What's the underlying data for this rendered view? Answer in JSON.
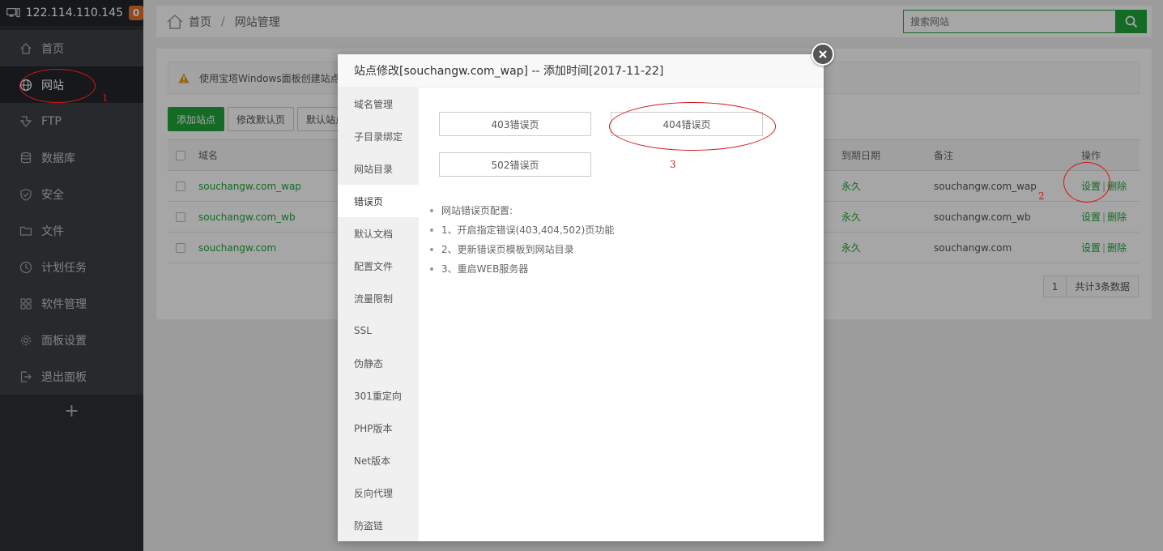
{
  "server": {
    "ip": "122.114.110.145",
    "badge": "0"
  },
  "sidebar": {
    "items": [
      {
        "label": "首页",
        "icon": "home-icon"
      },
      {
        "label": "网站",
        "icon": "globe-icon",
        "active": true
      },
      {
        "label": "FTP",
        "icon": "ftp-icon"
      },
      {
        "label": "数据库",
        "icon": "database-icon"
      },
      {
        "label": "安全",
        "icon": "shield-icon"
      },
      {
        "label": "文件",
        "icon": "folder-icon"
      },
      {
        "label": "计划任务",
        "icon": "clock-icon"
      },
      {
        "label": "软件管理",
        "icon": "grid-icon"
      },
      {
        "label": "面板设置",
        "icon": "gear-icon"
      },
      {
        "label": "退出面板",
        "icon": "logout-icon"
      }
    ],
    "add": "+"
  },
  "breadcrumb": {
    "home": "首页",
    "sep": "/",
    "current": "网站管理"
  },
  "search": {
    "placeholder": "搜索网站"
  },
  "notice": {
    "text": "使用宝塔Windows面板创建站点"
  },
  "toolbar": {
    "add_site": "添加站点",
    "modify_default": "修改默认页",
    "default_site": "默认站点"
  },
  "table": {
    "headers": {
      "domain": "域名",
      "expire": "到期日期",
      "remark": "备注",
      "ops": "操作"
    },
    "rows": [
      {
        "domain": "souchangw.com_wap",
        "expire": "永久",
        "remark": "souchangw.com_wap",
        "set": "设置",
        "sep": "|",
        "del": "删除"
      },
      {
        "domain": "souchangw.com_wb",
        "expire": "永久",
        "remark": "souchangw.com_wb",
        "set": "设置",
        "sep": "|",
        "del": "删除"
      },
      {
        "domain": "souchangw.com",
        "expire": "永久",
        "remark": "souchangw.com",
        "set": "设置",
        "sep": "|",
        "del": "删除"
      }
    ]
  },
  "pager": {
    "page": "1",
    "total": "共计3条数据"
  },
  "modal": {
    "title": "站点修改[souchangw.com_wap] -- 添加时间[2017-11-22]",
    "tabs": [
      "域名管理",
      "子目录绑定",
      "网站目录",
      "错误页",
      "默认文档",
      "配置文件",
      "流量限制",
      "SSL",
      "伪静态",
      "301重定向",
      "PHP版本",
      "Net版本",
      "反向代理",
      "防盗链"
    ],
    "active_tab": "错误页",
    "buttons": {
      "e403": "403错误页",
      "e404": "404错误页",
      "e502": "502错误页"
    },
    "help": [
      "网站错误页配置:",
      "1、开启指定错误(403,404,502)页功能",
      "2、更新错误页模板到网站目录",
      "3、重启WEB服务器"
    ]
  },
  "annotations": [
    "1",
    "2",
    "3"
  ],
  "colors": {
    "accent": "#20a53a",
    "sidebar": "#2f3136",
    "annotation": "#d4161a"
  }
}
